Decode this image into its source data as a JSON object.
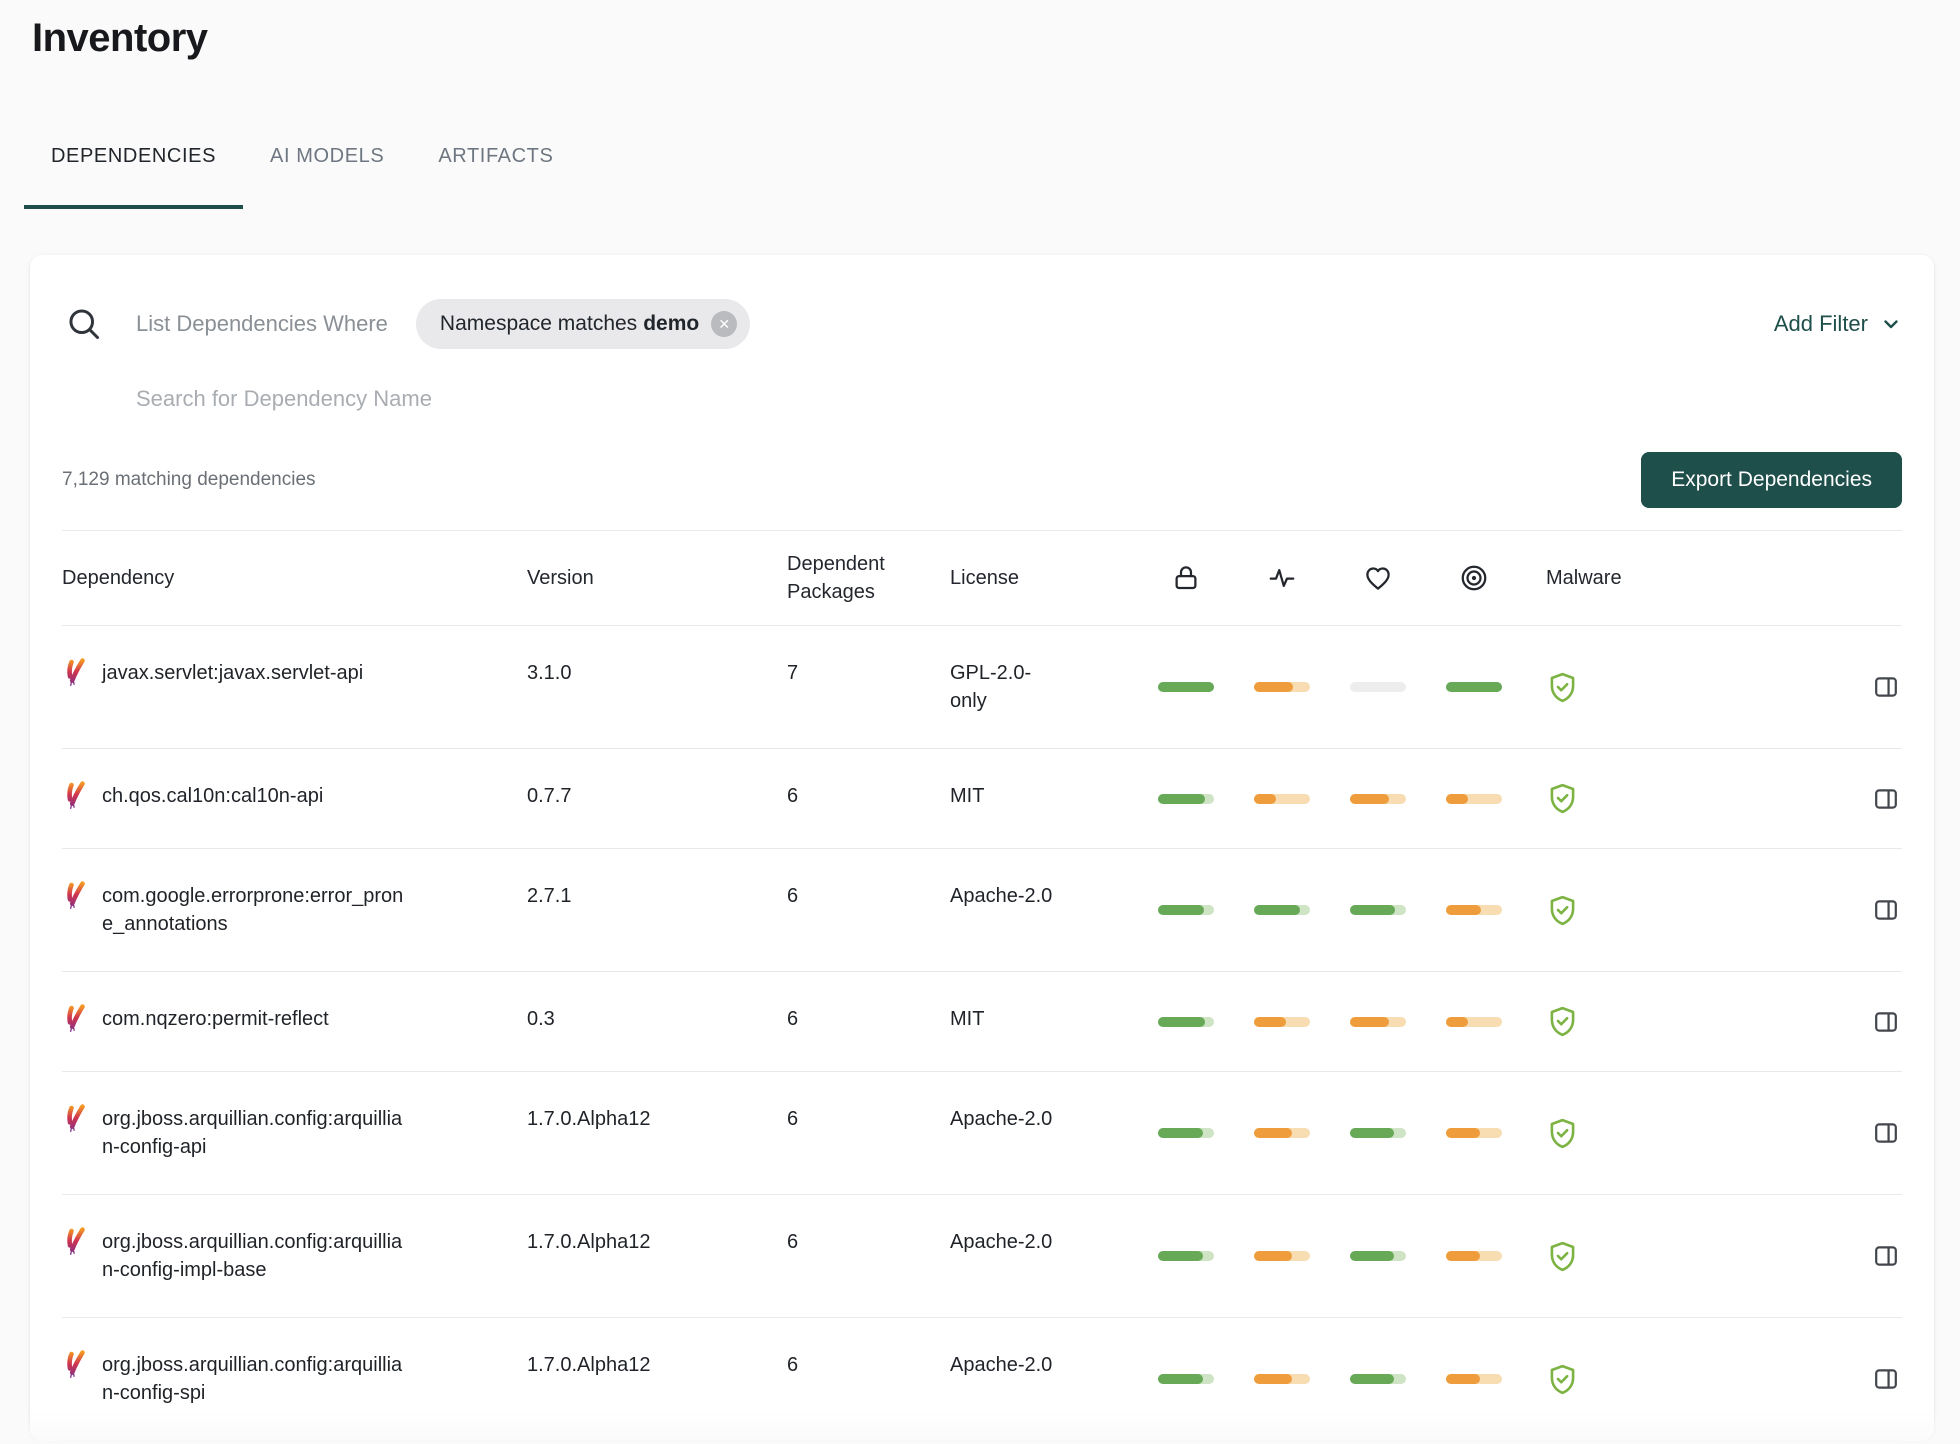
{
  "page": {
    "title": "Inventory"
  },
  "tabs": [
    {
      "label": "DEPENDENCIES",
      "active": true
    },
    {
      "label": "AI MODELS",
      "active": false
    },
    {
      "label": "ARTIFACTS",
      "active": false
    }
  ],
  "filters": {
    "prompt": "List Dependencies Where",
    "chip": {
      "field": "Namespace matches",
      "value": "demo"
    },
    "add_filter_label": "Add Filter",
    "search_placeholder": "Search for Dependency Name",
    "matching_count": "7,129 matching dependencies",
    "export_label": "Export Dependencies"
  },
  "table": {
    "columns": {
      "dependency": "Dependency",
      "version": "Version",
      "dependent_packages": "Dependent Packages",
      "license": "License",
      "malware": "Malware"
    },
    "icon_columns": [
      "lock",
      "activity",
      "heart",
      "target"
    ],
    "rows": [
      {
        "name": "javax.servlet:javax.servlet-api",
        "version": "3.1.0",
        "dependent_packages": "7",
        "license": "GPL-2.0-only",
        "scores": [
          {
            "color": "green",
            "pct": 100
          },
          {
            "color": "orange",
            "pct": 70
          },
          {
            "color": "empty",
            "pct": 0
          },
          {
            "color": "green",
            "pct": 100
          }
        ],
        "malware": "shield-check"
      },
      {
        "name": "ch.qos.cal10n:cal10n-api",
        "version": "0.7.7",
        "dependent_packages": "6",
        "license": "MIT",
        "scores": [
          {
            "color": "green",
            "pct": 84
          },
          {
            "color": "orange",
            "pct": 40
          },
          {
            "color": "orange",
            "pct": 70
          },
          {
            "color": "orange",
            "pct": 40
          }
        ],
        "malware": "shield-check"
      },
      {
        "name": "com.google.errorprone:error_prone_annotations",
        "version": "2.7.1",
        "dependent_packages": "6",
        "license": "Apache-2.0",
        "scores": [
          {
            "color": "green",
            "pct": 82
          },
          {
            "color": "green",
            "pct": 82
          },
          {
            "color": "green",
            "pct": 80
          },
          {
            "color": "orange",
            "pct": 62
          }
        ],
        "malware": "shield-check"
      },
      {
        "name": "com.nqzero:permit-reflect",
        "version": "0.3",
        "dependent_packages": "6",
        "license": "MIT",
        "scores": [
          {
            "color": "green",
            "pct": 84
          },
          {
            "color": "orange",
            "pct": 58
          },
          {
            "color": "orange",
            "pct": 70
          },
          {
            "color": "orange",
            "pct": 40
          }
        ],
        "malware": "shield-check"
      },
      {
        "name": "org.jboss.arquillian.config:arquillian-config-api",
        "version": "1.7.0.Alpha12",
        "dependent_packages": "6",
        "license": "Apache-2.0",
        "scores": [
          {
            "color": "green",
            "pct": 80
          },
          {
            "color": "orange",
            "pct": 68
          },
          {
            "color": "green",
            "pct": 78
          },
          {
            "color": "orange",
            "pct": 60
          }
        ],
        "malware": "shield-check"
      },
      {
        "name": "org.jboss.arquillian.config:arquillian-config-impl-base",
        "version": "1.7.0.Alpha12",
        "dependent_packages": "6",
        "license": "Apache-2.0",
        "scores": [
          {
            "color": "green",
            "pct": 80
          },
          {
            "color": "orange",
            "pct": 68
          },
          {
            "color": "green",
            "pct": 78
          },
          {
            "color": "orange",
            "pct": 60
          }
        ],
        "malware": "shield-check"
      },
      {
        "name": "org.jboss.arquillian.config:arquillian-config-spi",
        "version": "1.7.0.Alpha12",
        "dependent_packages": "6",
        "license": "Apache-2.0",
        "scores": [
          {
            "color": "green",
            "pct": 80
          },
          {
            "color": "orange",
            "pct": 68
          },
          {
            "color": "green",
            "pct": 78
          },
          {
            "color": "orange",
            "pct": 60
          }
        ],
        "malware": "shield-check"
      }
    ]
  },
  "icons": {
    "search": "magnifier",
    "chip_close": "circle-x",
    "add_filter": "chevron-down",
    "score_columns": [
      "lock",
      "activity",
      "heart",
      "target"
    ],
    "malware_ok": "shield-check",
    "row_action": "open-side-panel",
    "package_type": "maven-feather"
  },
  "colors": {
    "accent_teal": "#1f4f4b",
    "score_green": "#67a957",
    "score_green_track": "#cfe3c5",
    "score_orange": "#ef9d3c",
    "score_orange_track": "#f8dcb2",
    "score_empty_track": "#ededed",
    "shield_green": "#7cb342",
    "chip_background": "#e9e9eb"
  }
}
